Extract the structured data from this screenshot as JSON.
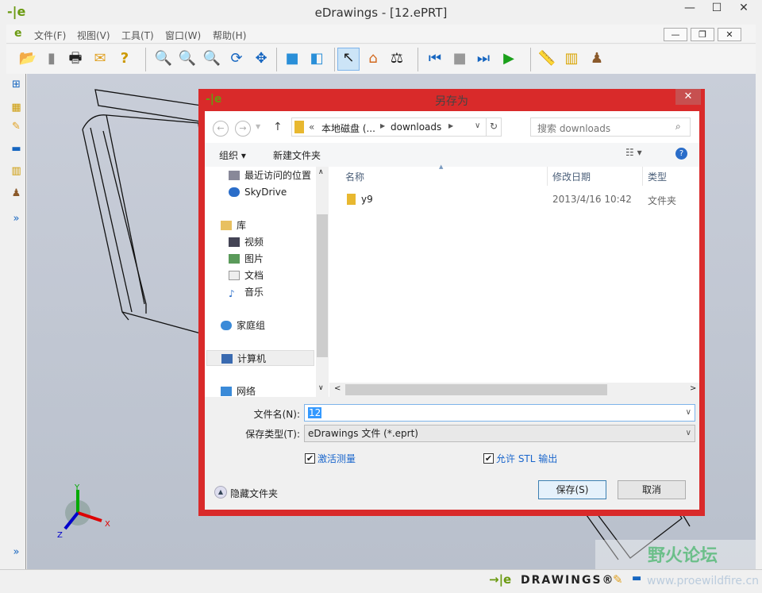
{
  "window": {
    "title": "eDrawings - [12.ePRT]",
    "minimize": "—",
    "maximize": "☐",
    "close": "✕"
  },
  "menu": {
    "items": [
      "文件(F)",
      "视图(V)",
      "工具(T)",
      "窗口(W)",
      "帮助(H)"
    ],
    "mdi_min": "—",
    "mdi_restore": "❐",
    "mdi_close": "✕"
  },
  "toolbar": {
    "icons": [
      "open-icon",
      "save-icon",
      "print-icon",
      "email-icon",
      "help-icon",
      "zoom-fit-icon",
      "zoom-area-icon",
      "zoom-icon",
      "rotate-icon",
      "pan-icon",
      "shaded-icon",
      "perspective-icon",
      "select-icon",
      "home-icon",
      "measure-icon",
      "previous-icon",
      "stop-icon",
      "next-icon",
      "play-icon",
      "measure-tape-icon",
      "section-icon",
      "stamp-icon"
    ]
  },
  "dialog": {
    "title": "另存为",
    "close": "✕",
    "address": {
      "prefix": "«",
      "part1": "本地磁盘 (...",
      "part2": "downloads"
    },
    "search_placeholder": "搜索 downloads",
    "organize": "组织 ▾",
    "new_folder": "新建文件夹",
    "nav": [
      {
        "label": "最近访问的位置"
      },
      {
        "label": "SkyDrive"
      },
      {
        "label": "库"
      },
      {
        "label": "视频"
      },
      {
        "label": "图片"
      },
      {
        "label": "文档"
      },
      {
        "label": "音乐"
      },
      {
        "label": "家庭组"
      },
      {
        "label": "计算机"
      },
      {
        "label": "网络"
      }
    ],
    "columns": [
      "名称",
      "修改日期",
      "类型"
    ],
    "files": [
      {
        "name": "y9",
        "modified": "2013/4/16 10:42",
        "type": "文件夹"
      }
    ],
    "filename_label": "文件名(N):",
    "filename_value": "12",
    "filetype_label": "保存类型(T):",
    "filetype_value": "eDrawings 文件 (*.eprt)",
    "opt1": "激活测量",
    "opt1_checked": true,
    "opt2": "允许 STL 输出",
    "opt2_checked": true,
    "hide_folders": "隐藏文件夹",
    "save": "保存(S)",
    "cancel": "取消"
  },
  "status": {
    "brand": "DRAWINGS®"
  },
  "watermark": {
    "text": "野火论坛",
    "url": "www.proewildfire.cn"
  },
  "axes": {
    "x": "X",
    "y": "Y",
    "z": "Z"
  }
}
